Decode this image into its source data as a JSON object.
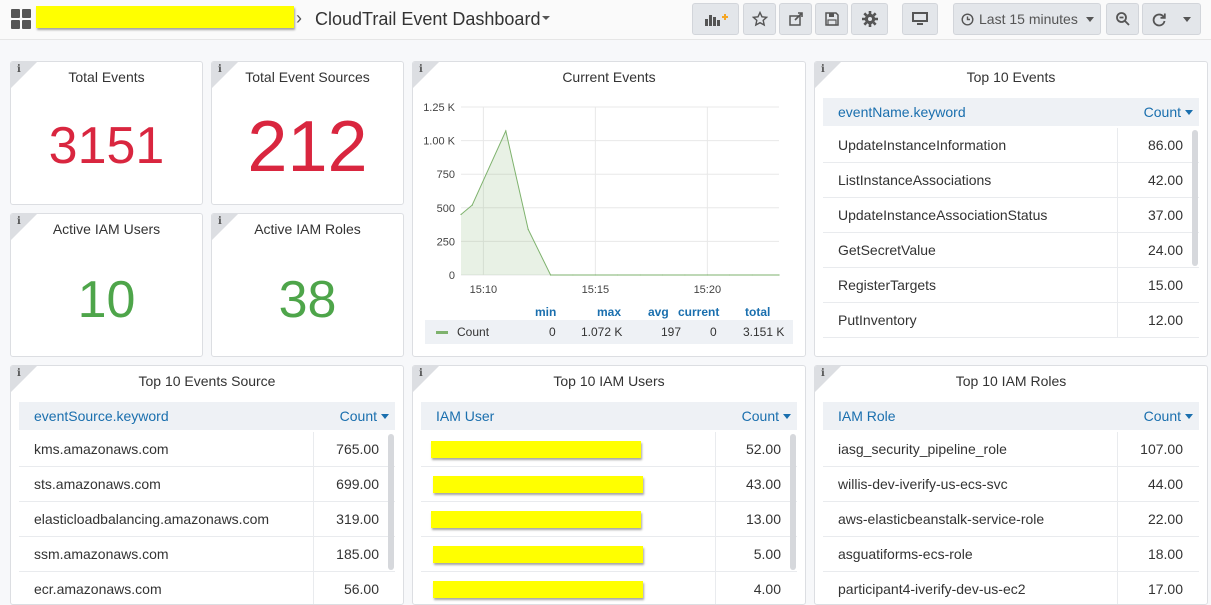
{
  "nav": {
    "title": "CloudTrail Event Dashboard",
    "breadcrumb_separator": "›",
    "time_range": "Last 15 minutes"
  },
  "stats": {
    "total_events": {
      "title": "Total Events",
      "value": "3151",
      "color": "#d9263f"
    },
    "total_sources": {
      "title": "Total Event Sources",
      "value": "212",
      "color": "#d9263f"
    },
    "iam_users": {
      "title": "Active IAM Users",
      "value": "10",
      "color": "#4ea54a"
    },
    "iam_roles": {
      "title": "Active IAM Roles",
      "value": "38",
      "color": "#4ea54a"
    }
  },
  "current_events": {
    "title": "Current Events",
    "legend": {
      "headers": [
        "min",
        "max",
        "avg",
        "current",
        "total"
      ],
      "series": "Count",
      "min": "0",
      "max": "1.072 K",
      "avg": "197",
      "current": "0",
      "total": "3.151 K"
    },
    "y_ticks": [
      "1.25 K",
      "1.00 K",
      "750",
      "500",
      "250",
      "0"
    ],
    "x_ticks": [
      "15:10",
      "15:15",
      "15:20"
    ]
  },
  "chart_data": {
    "type": "area",
    "title": "Current Events",
    "x": [
      "15:09",
      "15:09:30",
      "15:11",
      "15:12",
      "15:13",
      "15:14",
      "15:15",
      "15:16",
      "15:17",
      "15:18",
      "15:19",
      "15:20",
      "15:21",
      "15:22",
      "15:23"
    ],
    "series": [
      {
        "name": "Count",
        "values": [
          450,
          520,
          1072,
          340,
          0,
          0,
          0,
          0,
          0,
          0,
          0,
          0,
          0,
          0,
          0
        ]
      }
    ],
    "ylim": [
      0,
      1250
    ],
    "y_ticks": [
      0,
      250,
      500,
      750,
      1000,
      1250
    ],
    "x_tick_labels": [
      "15:10",
      "15:15",
      "15:20"
    ],
    "color": "#7eb26d",
    "grid": true
  },
  "top_events": {
    "title": "Top 10 Events",
    "col_name": "eventName.keyword",
    "col_count": "Count",
    "rows": [
      {
        "name": "UpdateInstanceInformation",
        "count": "86.00"
      },
      {
        "name": "ListInstanceAssociations",
        "count": "42.00"
      },
      {
        "name": "UpdateInstanceAssociationStatus",
        "count": "37.00"
      },
      {
        "name": "GetSecretValue",
        "count": "24.00"
      },
      {
        "name": "RegisterTargets",
        "count": "15.00"
      },
      {
        "name": "PutInventory",
        "count": "12.00"
      }
    ]
  },
  "top_sources": {
    "title": "Top 10 Events Source",
    "col_name": "eventSource.keyword",
    "col_count": "Count",
    "rows": [
      {
        "name": "kms.amazonaws.com",
        "count": "765.00"
      },
      {
        "name": "sts.amazonaws.com",
        "count": "699.00"
      },
      {
        "name": "elasticloadbalancing.amazonaws.com",
        "count": "319.00"
      },
      {
        "name": "ssm.amazonaws.com",
        "count": "185.00"
      },
      {
        "name": "ecr.amazonaws.com",
        "count": "56.00"
      }
    ]
  },
  "top_users": {
    "title": "Top 10 IAM Users",
    "col_name": "IAM User",
    "col_count": "Count",
    "rows": [
      {
        "count": "52.00"
      },
      {
        "count": "43.00"
      },
      {
        "count": "13.00"
      },
      {
        "count": "5.00"
      },
      {
        "count": "4.00"
      }
    ]
  },
  "top_roles": {
    "title": "Top 10 IAM Roles",
    "col_name": "IAM Role",
    "col_count": "Count",
    "rows": [
      {
        "name": "iasg_security_pipeline_role",
        "count": "107.00"
      },
      {
        "name": "willis-dev-iverify-us-ecs-svc",
        "count": "44.00"
      },
      {
        "name": "aws-elasticbeanstalk-service-role",
        "count": "22.00"
      },
      {
        "name": "asguatiforms-ecs-role",
        "count": "18.00"
      },
      {
        "name": "participant4-iverify-dev-us-ec2",
        "count": "17.00"
      }
    ]
  }
}
